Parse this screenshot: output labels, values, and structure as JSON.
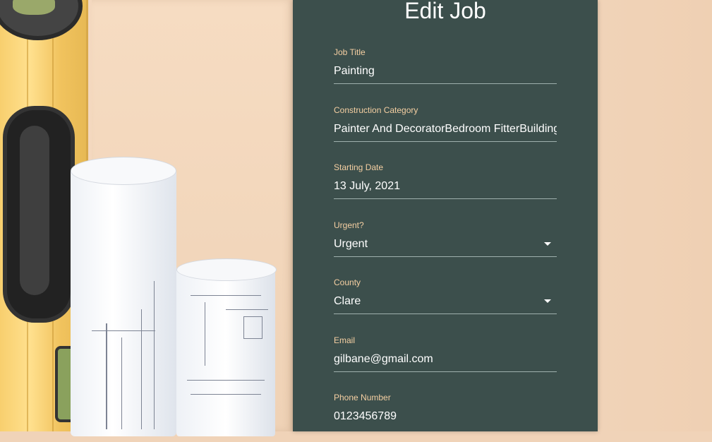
{
  "form": {
    "title": "Edit Job",
    "fields": {
      "job_title": {
        "label": "Job Title",
        "value": "Painting"
      },
      "category": {
        "label": "Construction Category",
        "value": "Painter And DecoratorBedroom FitterBuilding"
      },
      "start_date": {
        "label": "Starting Date",
        "value": "13 July, 2021"
      },
      "urgent": {
        "label": "Urgent?",
        "value": "Urgent"
      },
      "county": {
        "label": "County",
        "value": "Clare"
      },
      "email": {
        "label": "Email",
        "value": "gilbane@gmail.com"
      },
      "phone": {
        "label": "Phone Number",
        "value": "0123456789"
      }
    }
  },
  "colors": {
    "panel": "#3c4f4c",
    "label": "#f5cfa2",
    "text": "#ffffff"
  },
  "icons": {
    "select_caret": "triangle-down"
  }
}
